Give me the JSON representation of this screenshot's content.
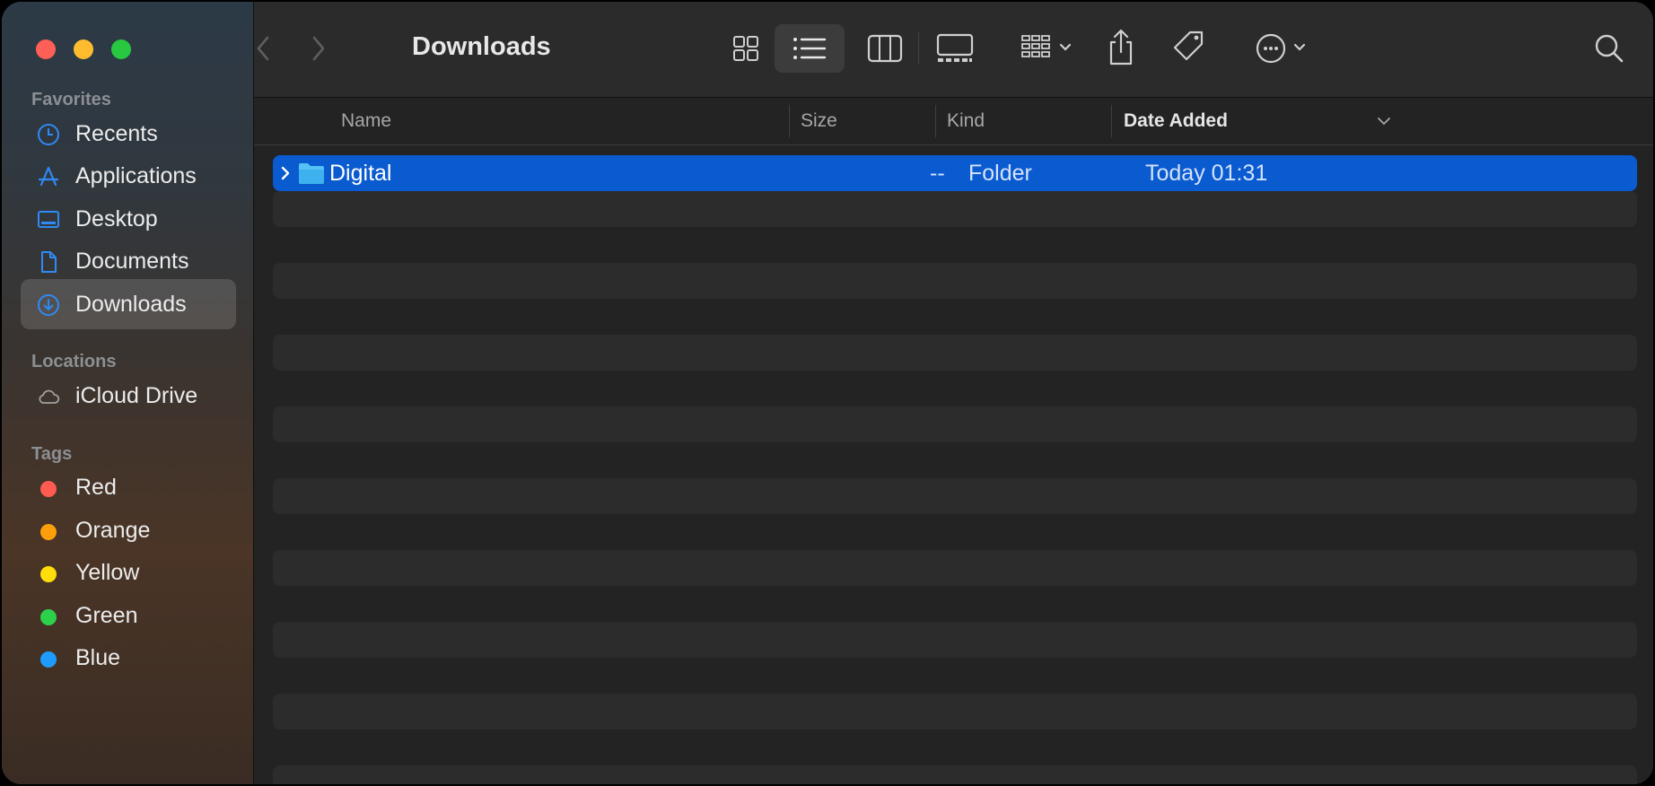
{
  "window": {
    "title": "Downloads"
  },
  "sidebar": {
    "favorites_title": "Favorites",
    "favorites": [
      {
        "label": "Recents",
        "icon": "clock-icon"
      },
      {
        "label": "Applications",
        "icon": "applications-icon"
      },
      {
        "label": "Desktop",
        "icon": "desktop-icon"
      },
      {
        "label": "Documents",
        "icon": "document-icon"
      },
      {
        "label": "Downloads",
        "icon": "download-icon",
        "active": true
      }
    ],
    "locations_title": "Locations",
    "locations": [
      {
        "label": "iCloud Drive",
        "icon": "cloud-icon"
      }
    ],
    "tags_title": "Tags",
    "tags": [
      {
        "label": "Red",
        "color": "#ff5b51"
      },
      {
        "label": "Orange",
        "color": "#fe9e0b"
      },
      {
        "label": "Yellow",
        "color": "#fedd0a"
      },
      {
        "label": "Green",
        "color": "#2bd14a"
      },
      {
        "label": "Blue",
        "color": "#1e9bfd"
      }
    ]
  },
  "toolbar": {
    "view_modes": [
      "icon-view",
      "list-view",
      "column-view",
      "gallery-view"
    ],
    "active_view": "list-view",
    "buttons": [
      "group-icon",
      "share-icon",
      "tag-icon",
      "more-icon",
      "search-icon"
    ]
  },
  "columns": {
    "name": "Name",
    "size": "Size",
    "kind": "Kind",
    "date_added": "Date Added",
    "sort_column": "Date Added"
  },
  "files": [
    {
      "name": "Digital",
      "size": "--",
      "kind": "Folder",
      "date_added": "Today 01:31",
      "selected": true,
      "icon": "folder-icon"
    }
  ],
  "colors": {
    "accent": "#0a5ad0",
    "selection": "#0a5ad0"
  }
}
